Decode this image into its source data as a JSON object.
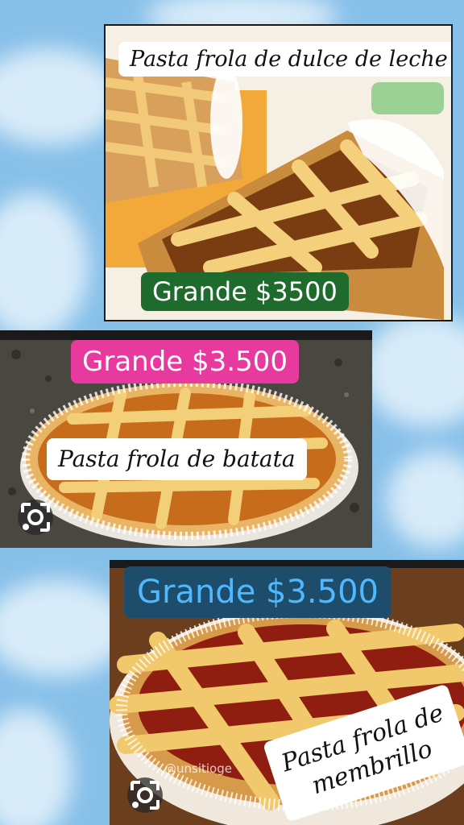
{
  "cards": [
    {
      "title": "Pasta frola de dulce de leche",
      "price": "Grande $3500",
      "price_bg": "#1f6b2e",
      "price_color": "#ffffff"
    },
    {
      "title": "Pasta frola de batata",
      "price": "Grande $3.500",
      "price_bg": "#e83a9e",
      "price_color": "#ffffff"
    },
    {
      "title_line1": "Pasta frola de",
      "title_line2": "membrillo",
      "price": "Grande $3.500",
      "price_bg": "#1d4d6b",
      "price_color": "#4fb8ff"
    }
  ],
  "watermark": "@unsitioge",
  "icons": {
    "lens": "google-lens-icon"
  },
  "colors": {
    "sky": "#8ec3ea",
    "cloud": "#d6ebf8"
  }
}
